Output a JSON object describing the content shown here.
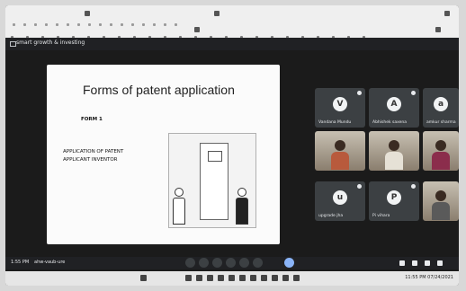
{
  "meeting": {
    "title": "smart growth & investing",
    "time": "1:55 PM",
    "code": "ahw-vaub-ure"
  },
  "slide": {
    "title": "Forms of patent application",
    "form": "FORM 1",
    "application_lines": [
      "APPLICATION OF PATENT",
      "APPLICANT INVENTOR"
    ]
  },
  "participants": [
    {
      "name": "Vandana Mundu",
      "initial": "V",
      "video": false
    },
    {
      "name": "Abhishek saxena",
      "initial": "A",
      "video": false
    },
    {
      "name": "amkur sharma",
      "initial": "a",
      "video": false
    },
    {
      "name": "",
      "initial": "",
      "video": true
    },
    {
      "name": "",
      "initial": "",
      "video": true
    },
    {
      "name": "",
      "initial": "",
      "video": true
    },
    {
      "name": "upgrade jha",
      "initial": "u",
      "video": false
    },
    {
      "name": "Pi vihara",
      "initial": "P",
      "video": false
    },
    {
      "name": "",
      "initial": "",
      "video": true
    }
  ],
  "taskbar": {
    "clock": "11:55 PM",
    "date": "07/24/2021"
  },
  "colors": {
    "meet_bg": "#1b1b1b",
    "tile_bg": "#3c4043",
    "active_control": "#8ab4f8"
  }
}
